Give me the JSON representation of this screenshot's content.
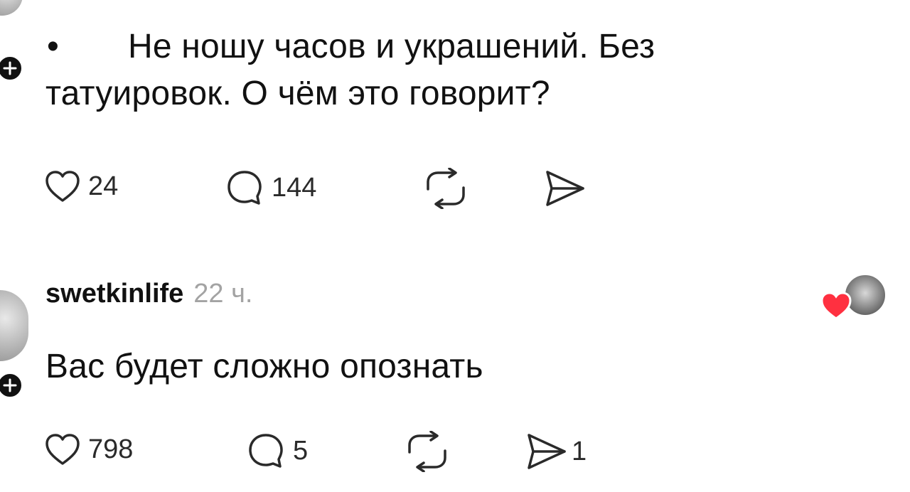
{
  "post": {
    "bullet": "•",
    "text_line1": "Не ношу часов и украшений. Без",
    "text_line2": "татуировок. О чём это говорит?",
    "actions": {
      "likes": "24",
      "comments": "144"
    }
  },
  "reply": {
    "username": "swetkinlife",
    "time": "22 ч.",
    "text": "Вас будет сложно опознать",
    "actions": {
      "likes": "798",
      "comments": "5",
      "shares": "1"
    }
  },
  "icons": {
    "like": "heart-outline-icon",
    "comment": "comment-bubble-icon",
    "repost": "repost-arrows-icon",
    "share": "send-icon",
    "liked_by_author": "heart-filled-icon"
  },
  "colors": {
    "text": "#111111",
    "muted": "#a3a3a3",
    "heart_red": "#ff3040"
  }
}
